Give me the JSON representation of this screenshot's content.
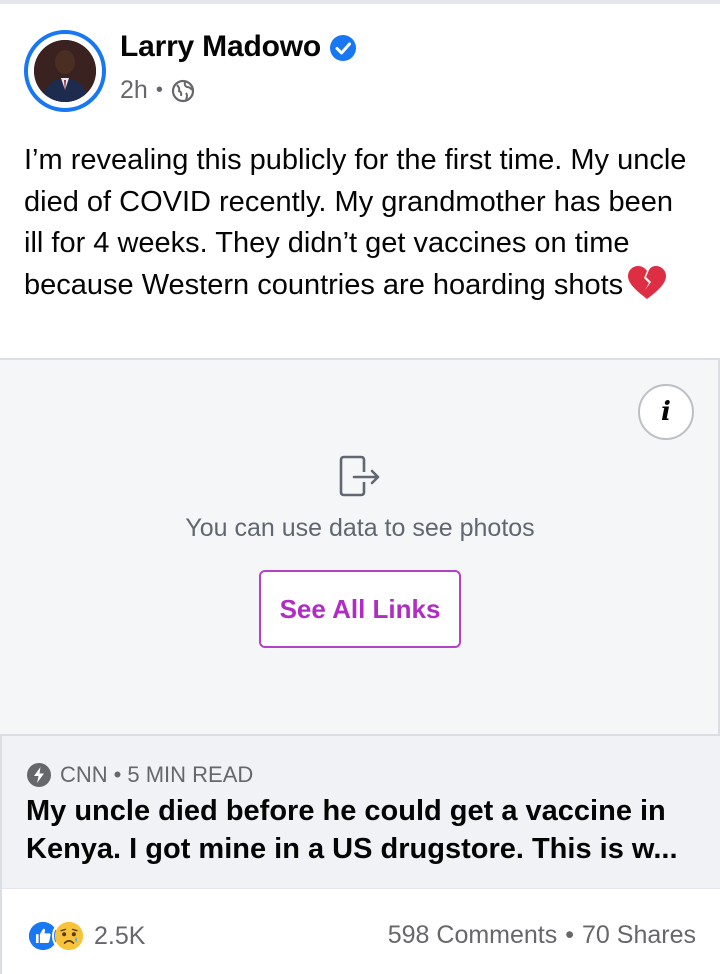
{
  "post": {
    "author": "Larry Madowo",
    "time": "2h",
    "separator": "•",
    "text": "I’m revealing this publicly for the first time. My uncle died of COVID recently. My grandmother has been ill for 4 weeks. They didn’t get vaccines on time because Western countries are hoarding shots"
  },
  "icons": {
    "verified": "verified-badge-icon",
    "privacy": "globe-icon",
    "emoji": "broken-heart-icon",
    "info": "info-icon",
    "data": "exit-arrow-icon",
    "source": "lightning-bolt-icon",
    "like": "like-reaction-icon",
    "sad": "sad-reaction-icon"
  },
  "media": {
    "info_label": "i",
    "message": "You can use data to see photos",
    "button_label": "See All Links"
  },
  "link": {
    "source": "CNN",
    "read_time": "5 MIN READ",
    "separator": "•",
    "headline": "My uncle died before he could get a vaccine in Kenya. I got mine in a US drugstore. This is w..."
  },
  "footer": {
    "reaction_count": "2.5K",
    "comments": "598 Comments",
    "separator": "•",
    "shares": "70 Shares"
  },
  "colors": {
    "accent_blue": "#1877f2",
    "link_purple": "#b02dc4",
    "secondary_text": "#65676b"
  }
}
